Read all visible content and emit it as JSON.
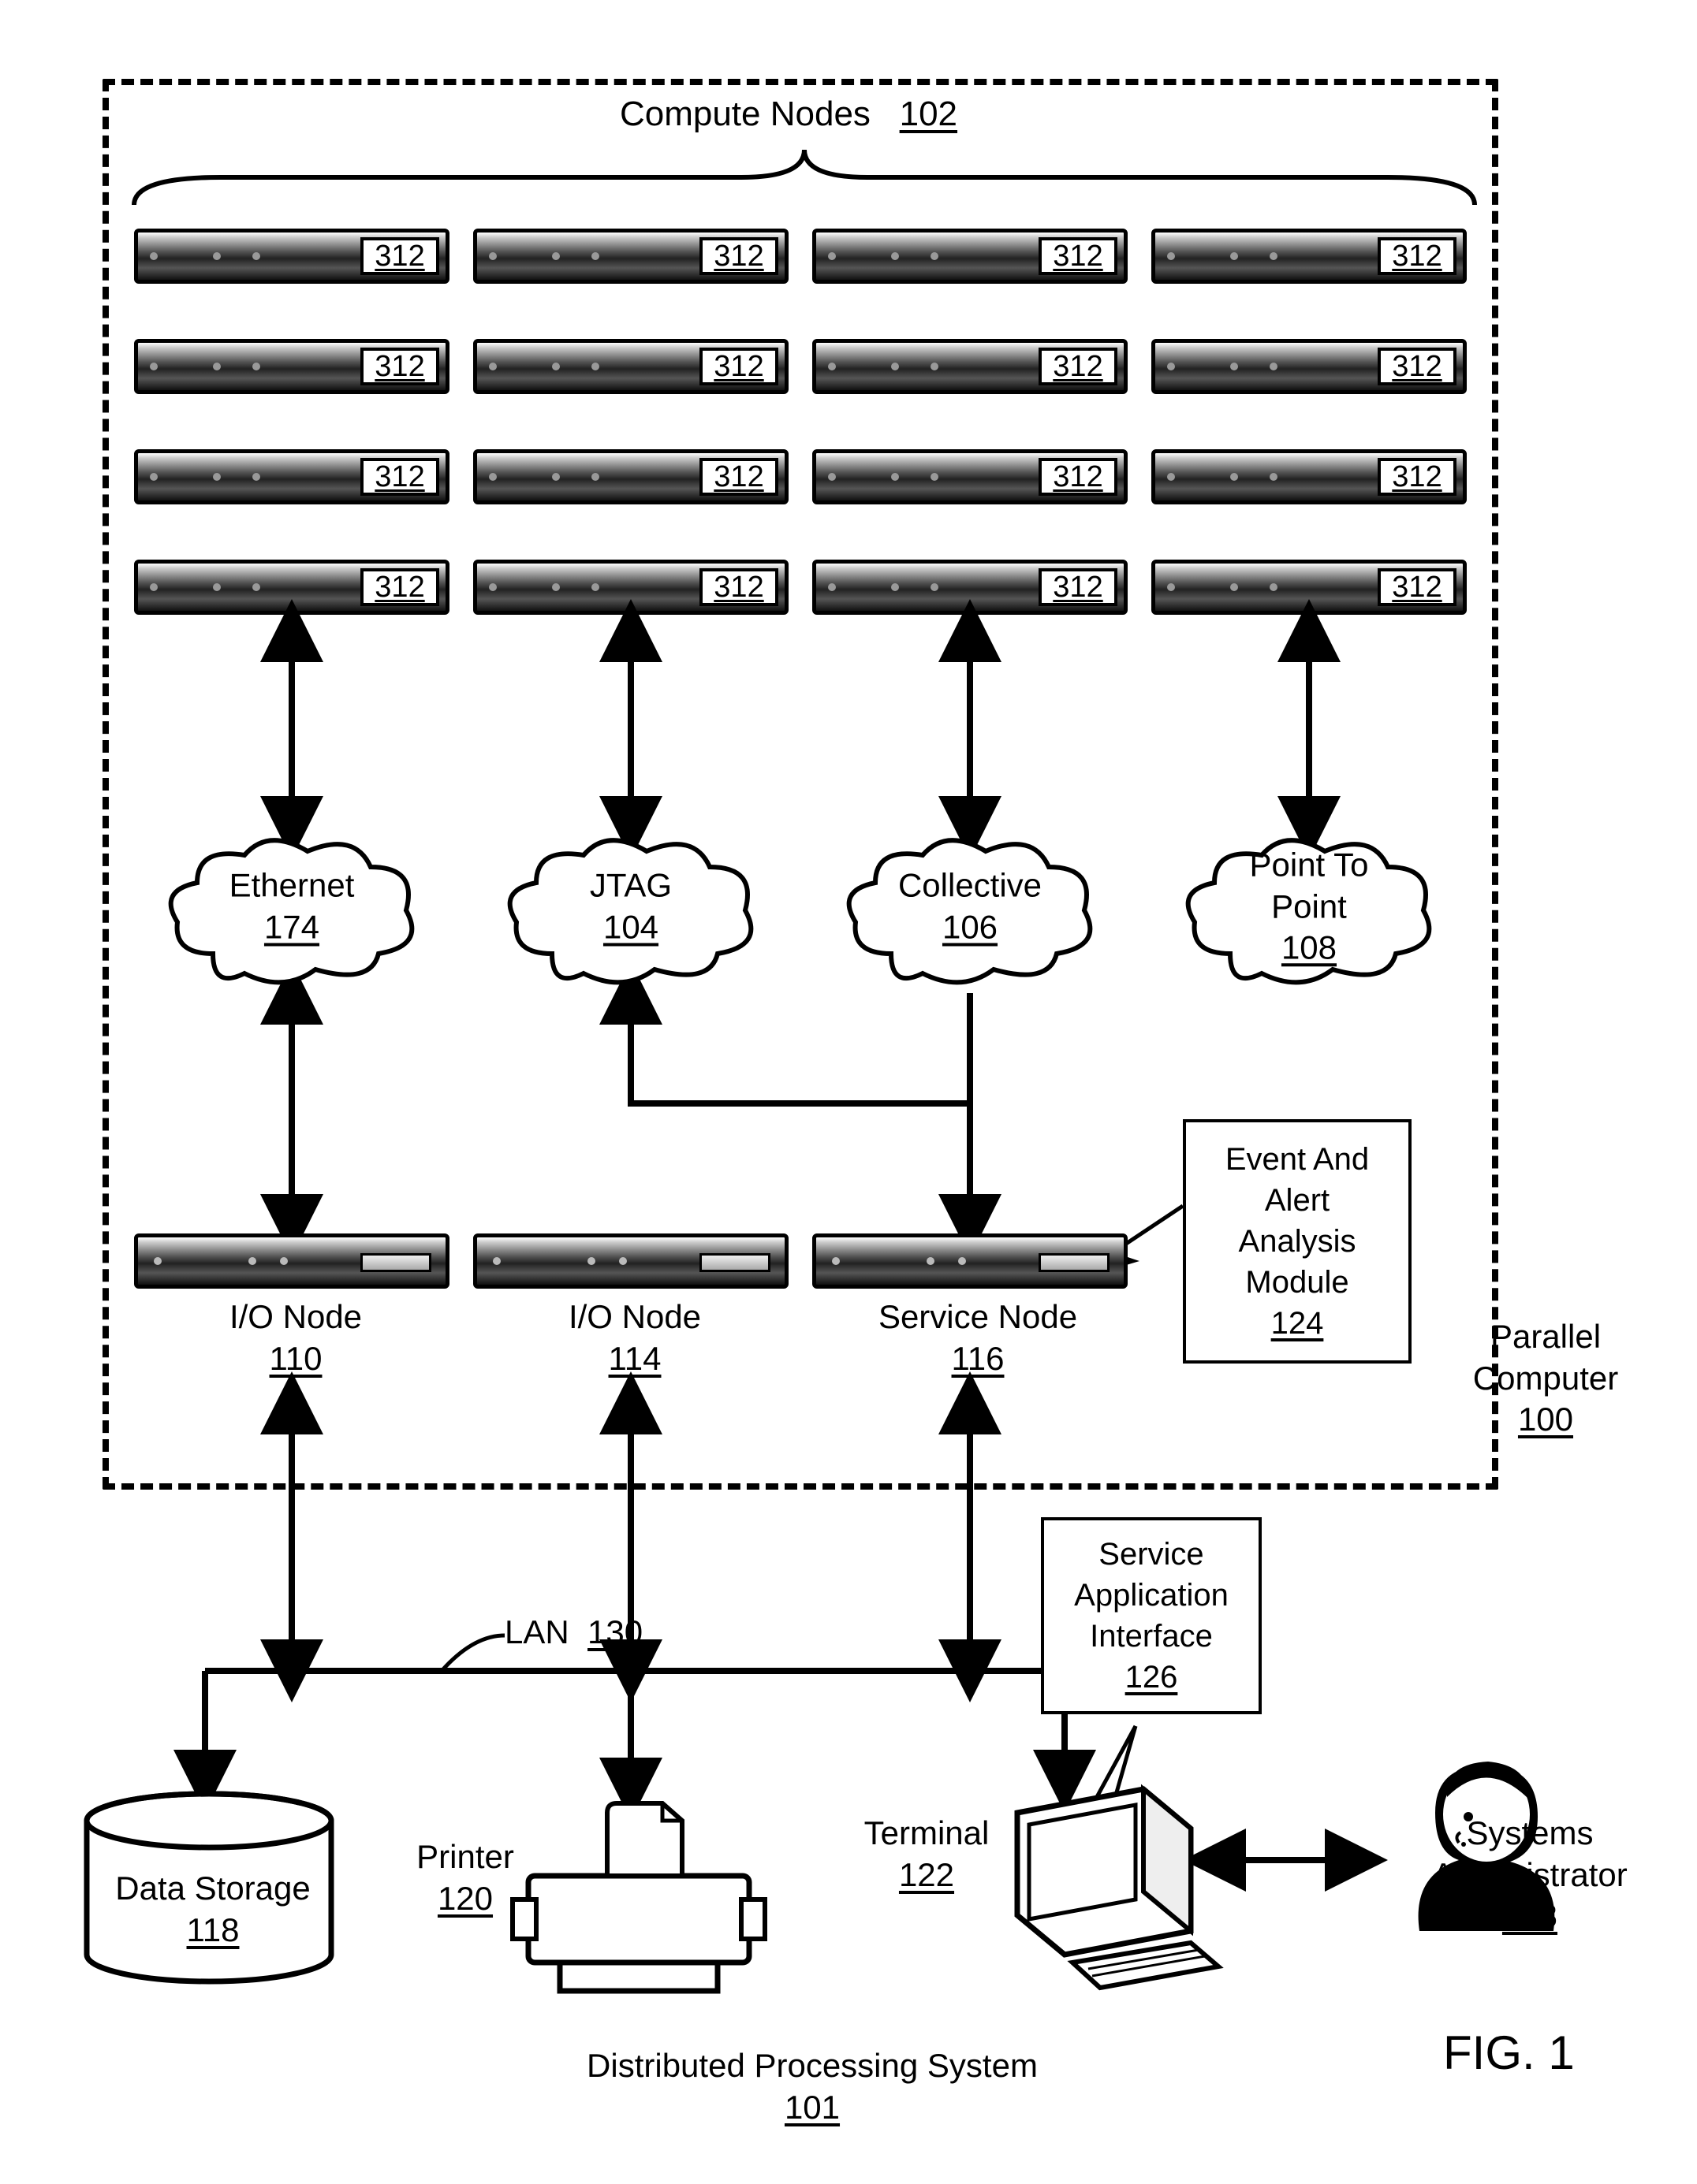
{
  "title_group": {
    "label": "Compute Nodes",
    "ref": "102"
  },
  "node_tag": "312",
  "networks": {
    "ethernet": {
      "label": "Ethernet",
      "ref": "174"
    },
    "jtag": {
      "label": "JTAG",
      "ref": "104"
    },
    "collective": {
      "label": "Collective",
      "ref": "106"
    },
    "p2p": {
      "label": "Point To Point",
      "ref": "108"
    }
  },
  "io1": {
    "label": "I/O Node",
    "ref": "110"
  },
  "io2": {
    "label": "I/O Node",
    "ref": "114"
  },
  "svc": {
    "label": "Service Node",
    "ref": "116"
  },
  "alert": {
    "l1": "Event And",
    "l2": "Alert",
    "l3": "Analysis",
    "l4": "Module",
    "ref": "124"
  },
  "parallel": {
    "label": "Parallel",
    "label2": "Computer",
    "ref": "100"
  },
  "sai": {
    "l1": "Service",
    "l2": "Application",
    "l3": "Interface",
    "ref": "126"
  },
  "lan": {
    "label": "LAN",
    "ref": "130"
  },
  "storage": {
    "label": "Data Storage",
    "ref": "118"
  },
  "printer": {
    "label": "Printer",
    "ref": "120"
  },
  "terminal": {
    "label": "Terminal",
    "ref": "122"
  },
  "admin": {
    "l1": "Systems",
    "l2": "Administrator",
    "ref": "128"
  },
  "system": {
    "label": "Distributed Processing System",
    "ref": "101"
  },
  "fig": "FIG. 1",
  "chart_data": {
    "type": "diagram",
    "title": "Distributed Processing System block diagram (FIG. 1)",
    "containers": [
      {
        "id": "100",
        "name": "Parallel Computer",
        "contains": [
          "102",
          "174",
          "104",
          "106",
          "108",
          "110",
          "114",
          "116",
          "124"
        ]
      },
      {
        "id": "101",
        "name": "Distributed Processing System",
        "contains": [
          "100",
          "130",
          "118",
          "120",
          "122",
          "126",
          "128"
        ]
      }
    ],
    "nodes": [
      {
        "id": "102",
        "name": "Compute Nodes",
        "kind": "group",
        "note": "4×4 grid of units each labeled 312"
      },
      {
        "id": "312",
        "name": "Compute Node Unit",
        "kind": "hardware",
        "count": 16
      },
      {
        "id": "174",
        "name": "Ethernet",
        "kind": "network-cloud"
      },
      {
        "id": "104",
        "name": "JTAG",
        "kind": "network-cloud"
      },
      {
        "id": "106",
        "name": "Collective",
        "kind": "network-cloud"
      },
      {
        "id": "108",
        "name": "Point To Point",
        "kind": "network-cloud"
      },
      {
        "id": "110",
        "name": "I/O Node",
        "kind": "hardware"
      },
      {
        "id": "114",
        "name": "I/O Node",
        "kind": "hardware"
      },
      {
        "id": "116",
        "name": "Service Node",
        "kind": "hardware"
      },
      {
        "id": "124",
        "name": "Event And Alert Analysis Module",
        "kind": "module",
        "callout_of": "116"
      },
      {
        "id": "126",
        "name": "Service Application Interface",
        "kind": "module",
        "callout_of": "122"
      },
      {
        "id": "130",
        "name": "LAN",
        "kind": "network-bus"
      },
      {
        "id": "118",
        "name": "Data Storage",
        "kind": "storage"
      },
      {
        "id": "120",
        "name": "Printer",
        "kind": "peripheral"
      },
      {
        "id": "122",
        "name": "Terminal",
        "kind": "workstation"
      },
      {
        "id": "128",
        "name": "Systems Administrator",
        "kind": "actor"
      }
    ],
    "edges": [
      {
        "from": "102",
        "to": "174",
        "dir": "both"
      },
      {
        "from": "102",
        "to": "104",
        "dir": "both"
      },
      {
        "from": "102",
        "to": "106",
        "dir": "both"
      },
      {
        "from": "102",
        "to": "108",
        "dir": "both"
      },
      {
        "from": "174",
        "to": "110",
        "dir": "both"
      },
      {
        "from": "104",
        "to": "116",
        "dir": "both"
      },
      {
        "from": "106",
        "to": "116",
        "dir": "both"
      },
      {
        "from": "110",
        "to": "130",
        "dir": "both"
      },
      {
        "from": "114",
        "to": "130",
        "dir": "both"
      },
      {
        "from": "116",
        "to": "130",
        "dir": "both"
      },
      {
        "from": "130",
        "to": "118",
        "dir": "both"
      },
      {
        "from": "130",
        "to": "120",
        "dir": "both"
      },
      {
        "from": "130",
        "to": "122",
        "dir": "both"
      },
      {
        "from": "122",
        "to": "128",
        "dir": "both"
      }
    ]
  }
}
